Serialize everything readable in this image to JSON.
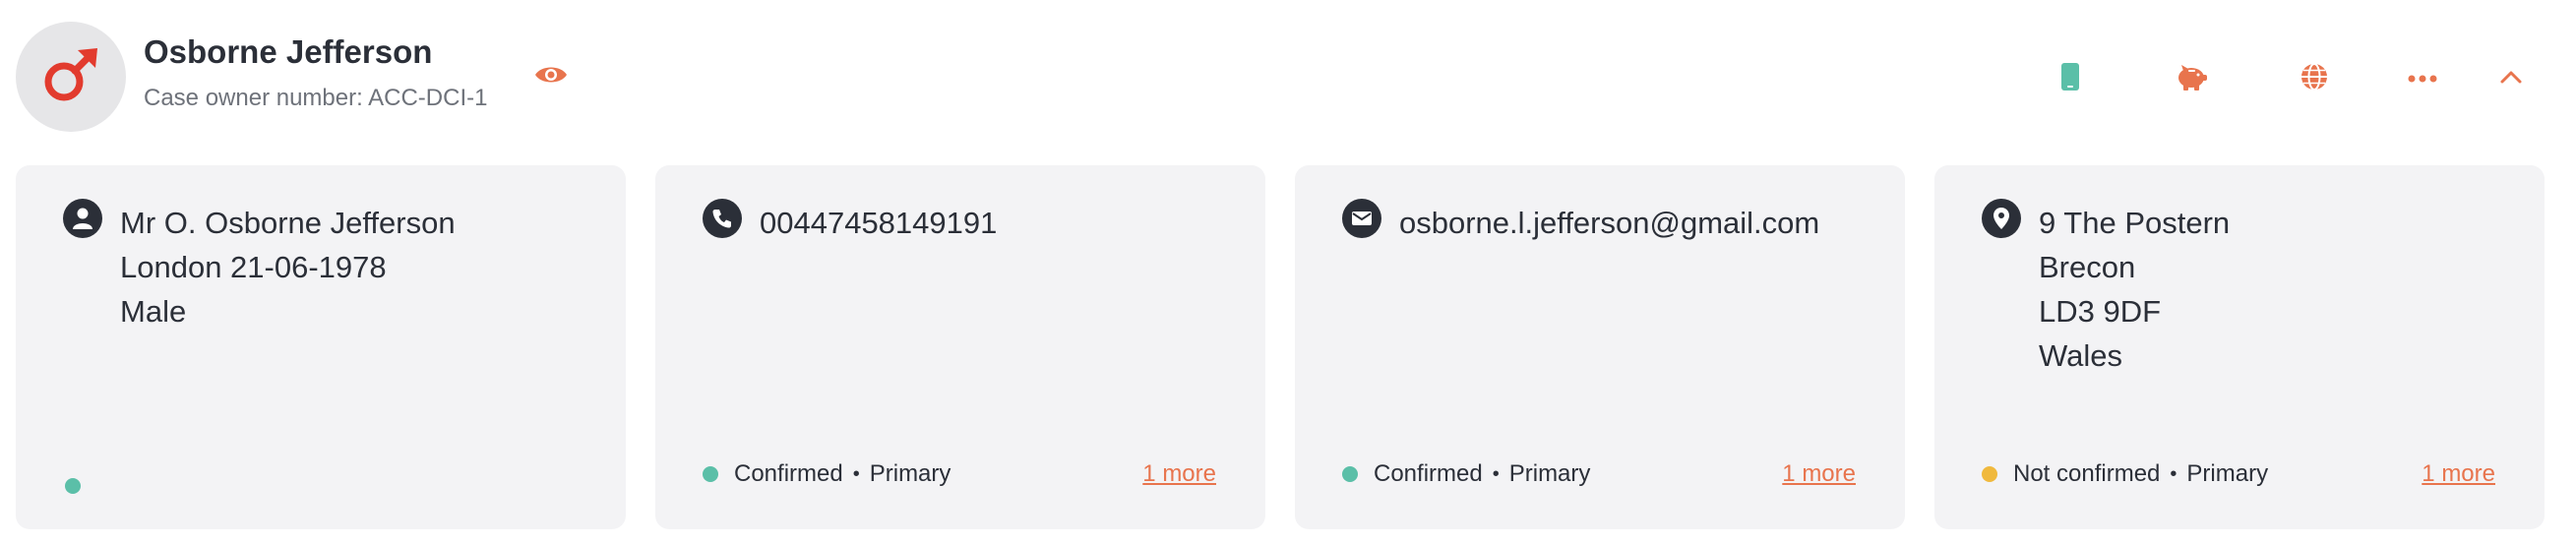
{
  "profile": {
    "name": "Osborne Jefferson",
    "case_owner_label": "Case owner number: ACC-DCI-1",
    "avatar_icon": "male-symbol-icon"
  },
  "toolbar": {
    "items": [
      {
        "icon": "mobile-phone-icon",
        "color": "#5bbfa8"
      },
      {
        "icon": "piggy-bank-icon",
        "color": "#e8744d"
      },
      {
        "icon": "globe-icon",
        "color": "#e8744d"
      },
      {
        "icon": "more-icon",
        "color": "#e8744d"
      },
      {
        "icon": "chevron-up-icon",
        "color": "#e8744d"
      }
    ]
  },
  "colors": {
    "accent": "#e8744d",
    "confirmed": "#5bbfa8",
    "not_confirmed": "#f0b93d",
    "card_bg": "#f3f3f5",
    "text_dark": "#2b2f38"
  },
  "cards": {
    "personal": {
      "icon": "person-icon",
      "lines": [
        "Mr O. Osborne Jefferson",
        "London 21-06-1978",
        "Male"
      ]
    },
    "phone": {
      "icon": "phone-icon",
      "value": "00447458149191",
      "status": "Confirmed",
      "type": "Primary",
      "more": "1 more"
    },
    "email": {
      "icon": "envelope-icon",
      "value": "osborne.l.jefferson@gmail.com",
      "status": "Confirmed",
      "type": "Primary",
      "more": "1 more"
    },
    "address": {
      "icon": "location-pin-icon",
      "lines": [
        "9 The Postern",
        "Brecon",
        "LD3 9DF",
        "Wales"
      ],
      "status": "Not confirmed",
      "type": "Primary",
      "more": "1 more"
    }
  }
}
